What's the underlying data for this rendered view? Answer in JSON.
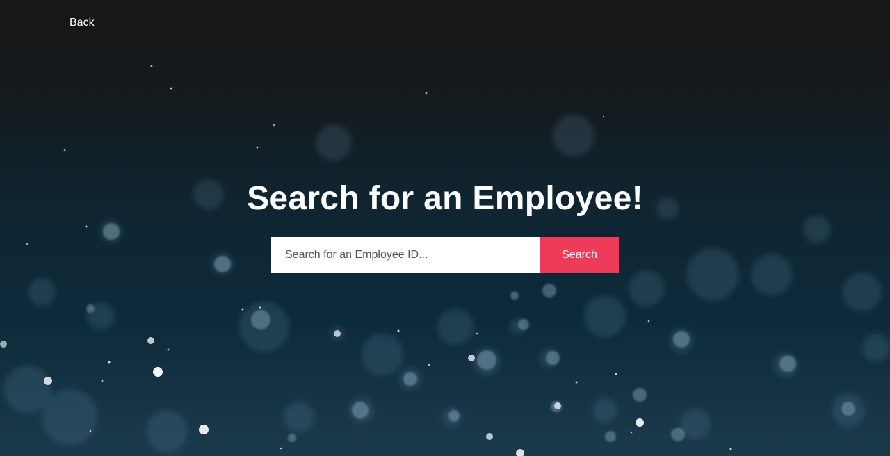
{
  "nav": {
    "back_label": "Back"
  },
  "hero": {
    "title": "Search for an Employee!",
    "search_placeholder": "Search for an Employee ID...",
    "search_value": "",
    "search_button_label": "Search"
  },
  "colors": {
    "accent": "#ef3b5a",
    "background_top": "#161717",
    "background_bottom": "#1b3a4c",
    "text": "#ffffff"
  }
}
